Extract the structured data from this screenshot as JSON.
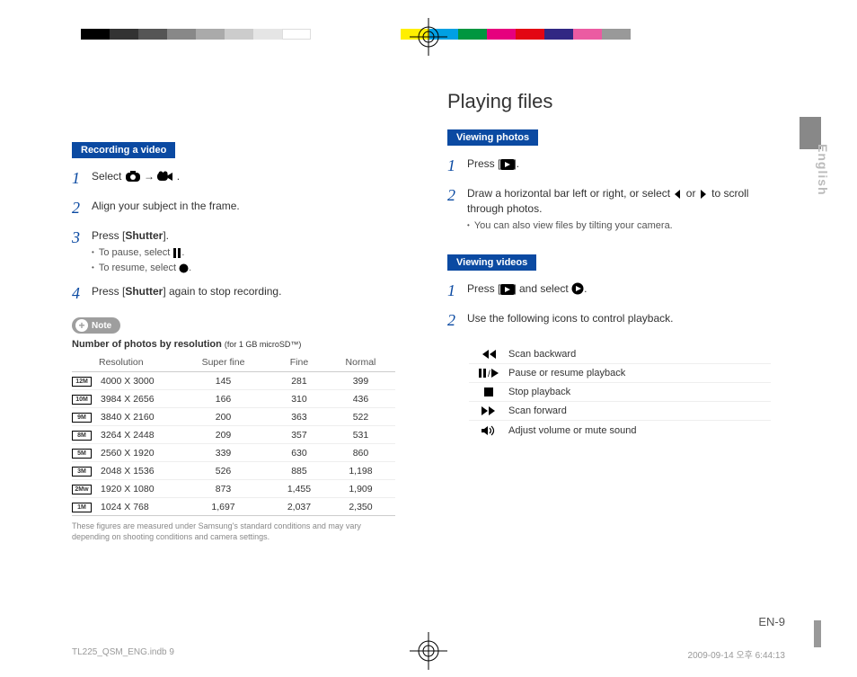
{
  "left": {
    "section_recording": "Recording a video",
    "step1_a": "Select ",
    "step1_b": " → ",
    "step1_c": ".",
    "step2": "Align your subject in the frame.",
    "step3_a": "Press [",
    "step3_shutter": "Shutter",
    "step3_b": "].",
    "step3_sub1_a": "To pause, select ",
    "step3_sub1_b": ".",
    "step3_sub2_a": "To resume, select ",
    "step3_sub2_b": ".",
    "step4_a": "Press [",
    "step4_shutter": "Shutter",
    "step4_b": "] again to stop recording.",
    "note_label": "Note",
    "note_title_a": "Number of photos by resolution ",
    "note_title_b": "(for 1 GB microSD™)",
    "table_headers": {
      "h1": "Resolution",
      "h2": "Super fine",
      "h3": "Fine",
      "h4": "Normal"
    },
    "table_rows": [
      {
        "tag": "12M",
        "res": "4000 X 3000",
        "sf": "145",
        "f": "281",
        "n": "399"
      },
      {
        "tag": "10M",
        "res": "3984 X 2656",
        "sf": "166",
        "f": "310",
        "n": "436"
      },
      {
        "tag": "9M",
        "res": "3840 X 2160",
        "sf": "200",
        "f": "363",
        "n": "522"
      },
      {
        "tag": "8M",
        "res": "3264 X 2448",
        "sf": "209",
        "f": "357",
        "n": "531"
      },
      {
        "tag": "5M",
        "res": "2560 X 1920",
        "sf": "339",
        "f": "630",
        "n": "860"
      },
      {
        "tag": "3M",
        "res": "2048 X 1536",
        "sf": "526",
        "f": "885",
        "n": "1,198"
      },
      {
        "tag": "2Mw",
        "res": "1920 X 1080",
        "sf": "873",
        "f": "1,455",
        "n": "1,909"
      },
      {
        "tag": "1M",
        "res": "1024 X 768",
        "sf": "1,697",
        "f": "2,037",
        "n": "2,350"
      }
    ],
    "footnote": "These figures are measured under Samsung's standard conditions and may vary depending on shooting conditions and camera settings."
  },
  "right": {
    "title": "Playing files",
    "section_photos": "Viewing photos",
    "p_step1_a": "Press [",
    "p_step1_b": "].",
    "p_step2_a": "Draw a horizontal bar left or right, or select ",
    "p_step2_b": " or ",
    "p_step2_c": " to scroll through photos.",
    "p_step2_sub": "You can also view files by tilting your camera.",
    "section_videos": "Viewing videos",
    "v_step1_a": "Press [",
    "v_step1_b": "] and select ",
    "v_step1_c": ".",
    "v_step2": "Use the following icons to control playback.",
    "playback": [
      {
        "icon": "rewind",
        "label": "Scan backward"
      },
      {
        "icon": "pauseplay",
        "label": "Pause or resume playback"
      },
      {
        "icon": "stop",
        "label": "Stop playback"
      },
      {
        "icon": "forward",
        "label": "Scan forward"
      },
      {
        "icon": "volume",
        "label": "Adjust volume or mute sound"
      }
    ]
  },
  "side_tab": "English",
  "page_num": "EN-9",
  "footer_left": "TL225_QSM_ENG.indb   9",
  "footer_right": "2009-09-14   오후 6:44:13"
}
